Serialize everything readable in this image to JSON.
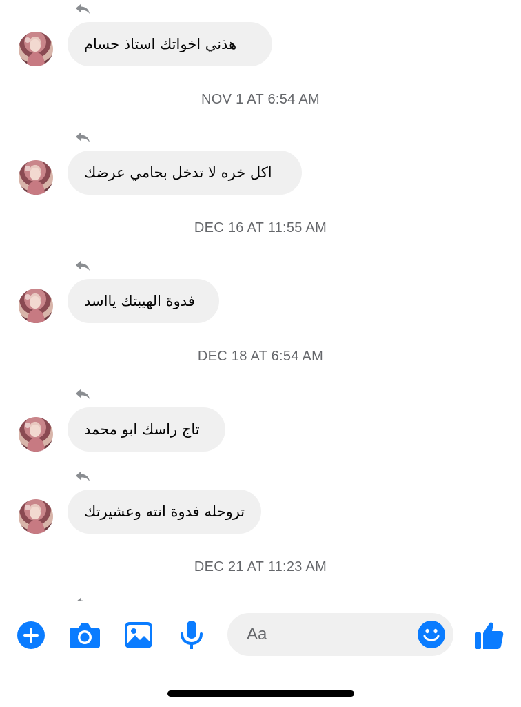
{
  "conversation": {
    "messages": [
      {
        "text": "هذني اخواتك استاذ حسام"
      },
      {
        "text": "اكل خره لا تدخل بحامي عرضك"
      },
      {
        "text": "فدوة الهيبتك يااسد"
      },
      {
        "text": "تاج راسك ابو محمد"
      },
      {
        "text": "تروحله فدوة انته وعشيرتك"
      }
    ],
    "timestamps": [
      "NOV 1 AT 6:54 AM",
      "DEC 16 AT 11:55 AM",
      "DEC 18 AT 6:54 AM",
      "DEC 21 AT 11:23 AM"
    ]
  },
  "composer": {
    "placeholder": "Aa",
    "icons": [
      "plus-circle-icon",
      "camera-icon",
      "image-icon",
      "microphone-icon",
      "emoji-icon",
      "thumbs-up-icon"
    ]
  },
  "colors": {
    "accent": "#0a7cff",
    "bubble_bg": "#f0f0f0",
    "timestamp_text": "#65676b",
    "reply_glyph": "#8a8d91"
  }
}
